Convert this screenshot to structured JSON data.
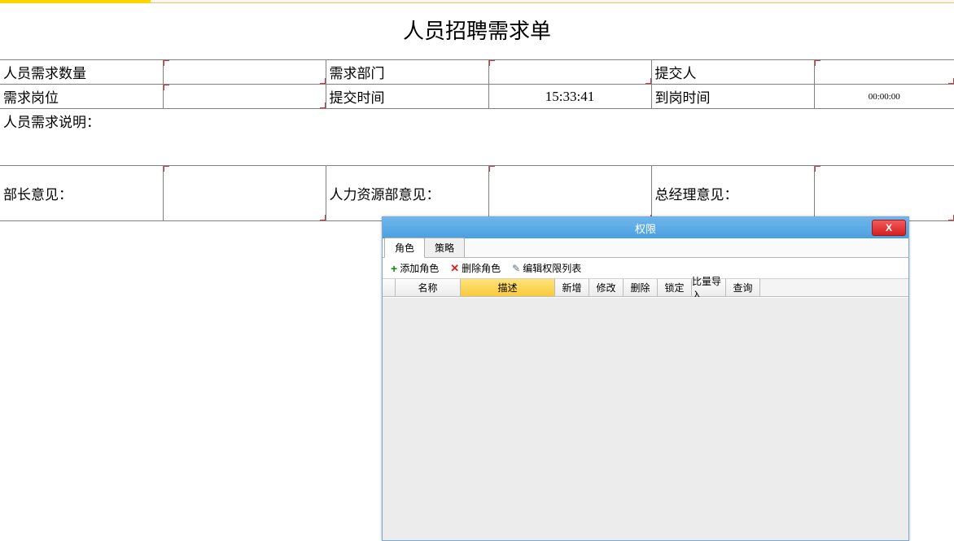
{
  "title": "人员招聘需求单",
  "form": {
    "row1": {
      "qty_label": "人员需求数量",
      "qty_value": "",
      "dept_label": "需求部门",
      "dept_value": "",
      "submitter_label": "提交人",
      "submitter_value": ""
    },
    "row2": {
      "post_label": "需求岗位",
      "post_value": "",
      "submit_time_label": "提交时间",
      "submit_time_value": "15:33:41",
      "arrival_time_label": "到岗时间",
      "arrival_time_value": "00:00:00"
    },
    "desc_label": "人员需求说明：",
    "opinion1_label": "部长意见：",
    "opinion2_label": "人力资源部意见：",
    "opinion3_label": "总经理意见："
  },
  "dialog": {
    "title": "权限",
    "close": "X",
    "tabs": [
      "角色",
      "策略"
    ],
    "toolbar": {
      "add": "添加角色",
      "del": "删除角色",
      "edit": "编辑权限列表"
    },
    "grid_headers": {
      "name": "名称",
      "desc": "描述",
      "add": "新增",
      "mod": "修改",
      "del": "删除",
      "lock": "锁定",
      "batch": "比量导入",
      "query": "查询"
    }
  }
}
